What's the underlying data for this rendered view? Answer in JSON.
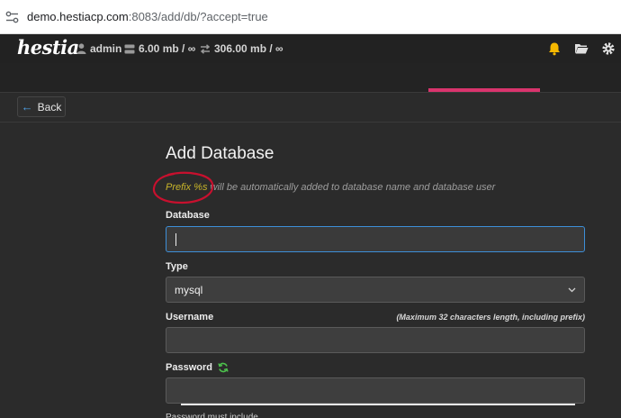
{
  "browser": {
    "url_host": "demo.hestiacp.com",
    "url_path": ":8083/add/db/?accept=true"
  },
  "topbar": {
    "logo": "hestia",
    "user": "admin",
    "disk": "6.00 mb / ∞",
    "bandwidth": "306.00 mb / ∞"
  },
  "toolbar": {
    "back_label": "Back"
  },
  "form": {
    "title": "Add Database",
    "hint_prefix": "Prefix %s",
    "hint_rest": " will be automatically added to database name and database user",
    "database_label": "Database",
    "database_value": "",
    "type_label": "Type",
    "type_value": "mysql",
    "username_label": "Username",
    "username_note": "(Maximum 32 characters length, including prefix)",
    "username_value": "",
    "password_label": "Password",
    "password_value": "",
    "password_hint": "Password must include"
  },
  "colors": {
    "accent_active_tab": "#d9346d",
    "focus_border": "#3d8fd8",
    "annotation": "#c8102e",
    "bell": "#f5b800"
  }
}
